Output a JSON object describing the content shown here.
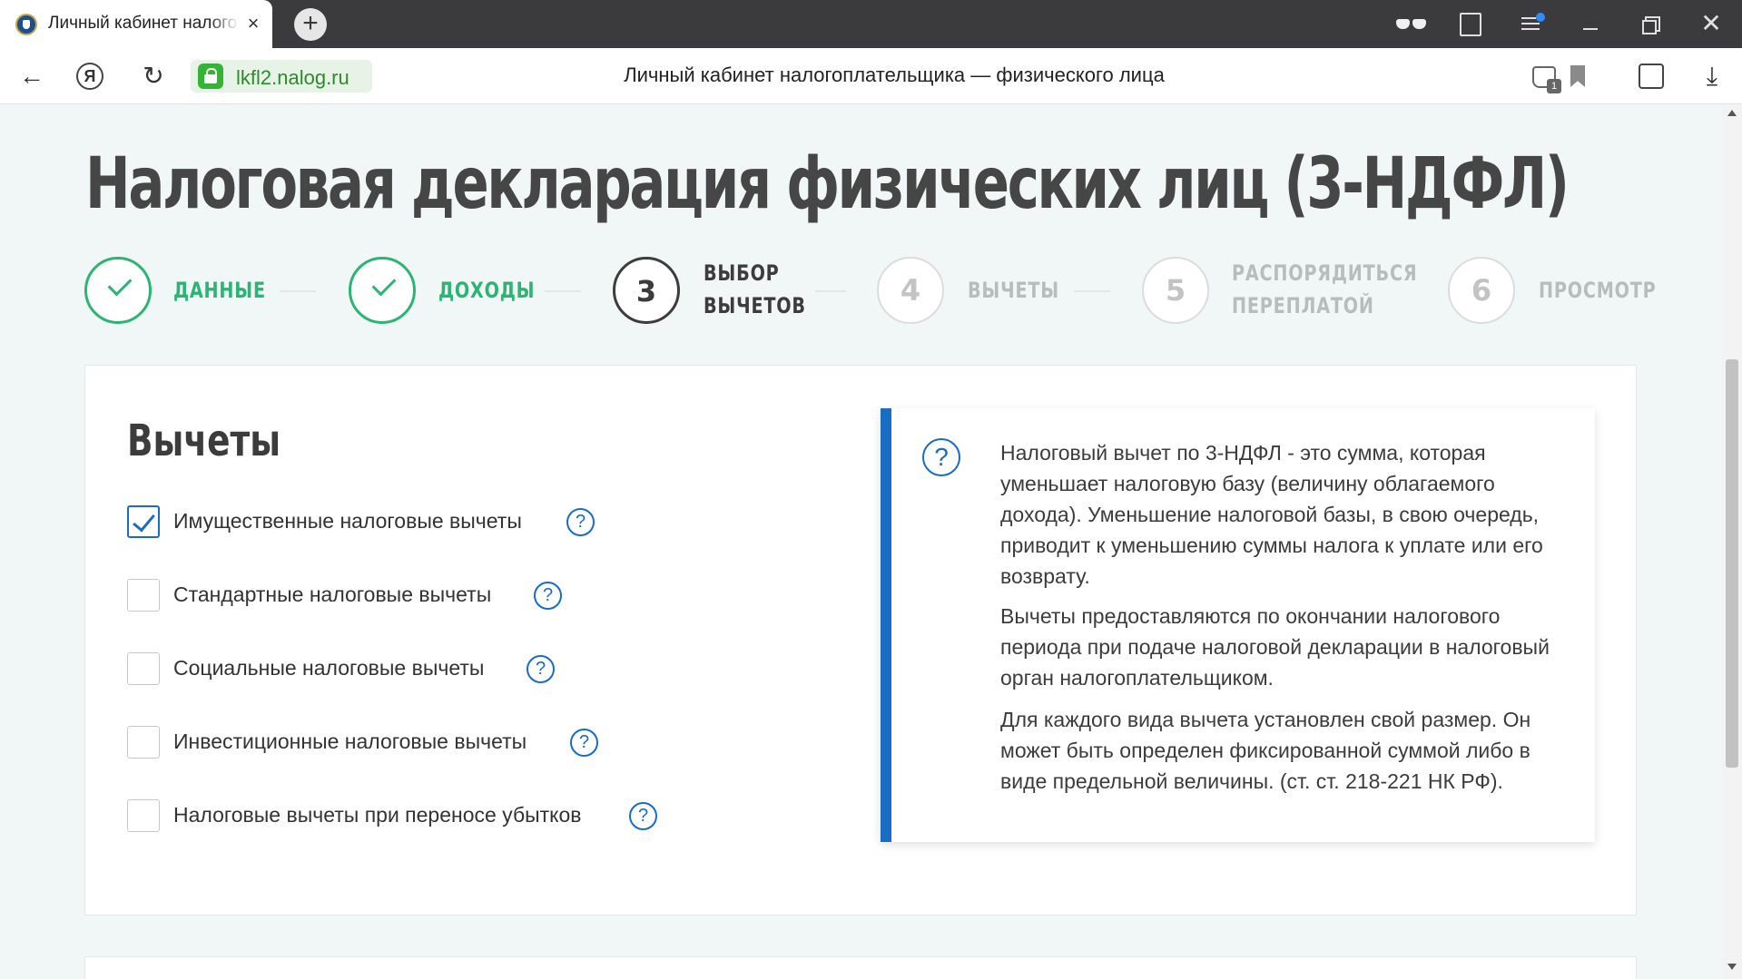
{
  "browser": {
    "tab_title": "Личный кабинет налогоплательщика",
    "tab_close": "×",
    "new_tab": "+",
    "close_window": "✕",
    "url": "lkfl2.nalog.ru",
    "page_title": "Личный кабинет налогоплательщика — физического лица",
    "yandex_letter": "Я",
    "back_glyph": "←",
    "reload_glyph": "↻",
    "download_glyph": "⤓",
    "extensions_badge": "1"
  },
  "page": {
    "heading": "Налоговая декларация физических лиц (3-НДФЛ)"
  },
  "stepper": {
    "steps": [
      {
        "number": "",
        "label_line1": "ДАННЫЕ",
        "label_line2": "",
        "state": "done"
      },
      {
        "number": "",
        "label_line1": "ДОХОДЫ",
        "label_line2": "",
        "state": "done"
      },
      {
        "number": "3",
        "label_line1": "ВЫБОР",
        "label_line2": "ВЫЧЕТОВ",
        "state": "current"
      },
      {
        "number": "4",
        "label_line1": "ВЫЧЕТЫ",
        "label_line2": "",
        "state": "future"
      },
      {
        "number": "5",
        "label_line1": "РАСПОРЯДИТЬСЯ",
        "label_line2": "ПЕРЕПЛАТОЙ",
        "state": "future"
      },
      {
        "number": "6",
        "label_line1": "ПРОСМОТР",
        "label_line2": "",
        "state": "future"
      }
    ]
  },
  "deductions": {
    "title": "Вычеты",
    "help_glyph": "?",
    "options": [
      {
        "label": "Имущественные налоговые вычеты",
        "checked": true
      },
      {
        "label": "Стандартные налоговые вычеты",
        "checked": false
      },
      {
        "label": "Социальные налоговые вычеты",
        "checked": false
      },
      {
        "label": "Инвестиционные налоговые вычеты",
        "checked": false
      },
      {
        "label": "Налоговые вычеты при переносе убытков",
        "checked": false
      }
    ]
  },
  "info": {
    "icon_glyph": "?",
    "paragraphs": [
      "Налоговый вычет по 3-НДФЛ - это сумма, которая уменьшает налоговую базу (величину облагаемого дохода). Уменьшение налоговой базы, в свою очередь, приводит к уменьшению суммы налога к уплате или его возврату.",
      "Вычеты предоставляются по окончании налогового периода при подаче налоговой декларации в налоговый орган налогоплательщиком.",
      "Для каждого вида вычета установлен свой размер. Он может быть определен фиксированной суммой либо в виде предельной величины. (ст. ст. 218-221 НК РФ)."
    ]
  },
  "colors": {
    "accent_blue": "#1a6dc4",
    "done_green": "#2bb573",
    "page_background": "#f1f6f6"
  }
}
